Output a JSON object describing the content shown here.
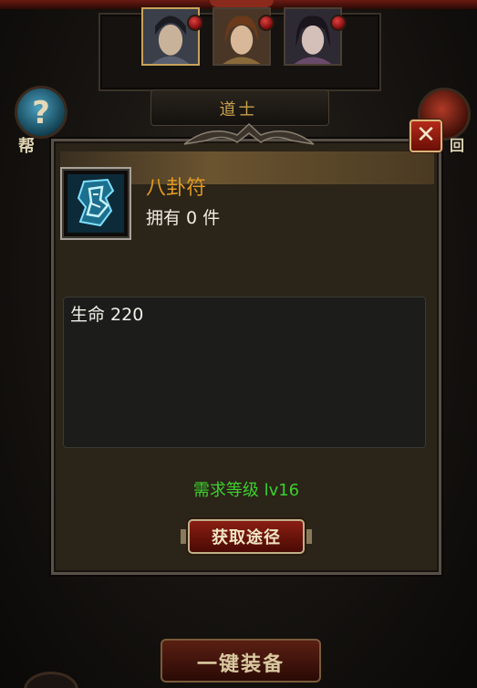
{
  "hero_select": {
    "portraits": [
      "portrait-1",
      "portrait-2",
      "portrait-3"
    ],
    "selected_index": 0,
    "class_label": "道士"
  },
  "side": {
    "help_glyph": "?",
    "help_label": "帮",
    "back_label": "回"
  },
  "bottom": {
    "equip_all_label": "一键装备"
  },
  "item_popup": {
    "close_glyph": "✕",
    "icon": "bagua-talisman-icon",
    "name": "八卦符",
    "count_text": "拥有 0 件",
    "stats": [
      "生命 220"
    ],
    "requirement": "需求等级 lv16",
    "source_button": "获取途径"
  },
  "colors": {
    "item_name": "#e09a22",
    "requirement": "#3bd02c",
    "close_button": "#b52a1a"
  }
}
